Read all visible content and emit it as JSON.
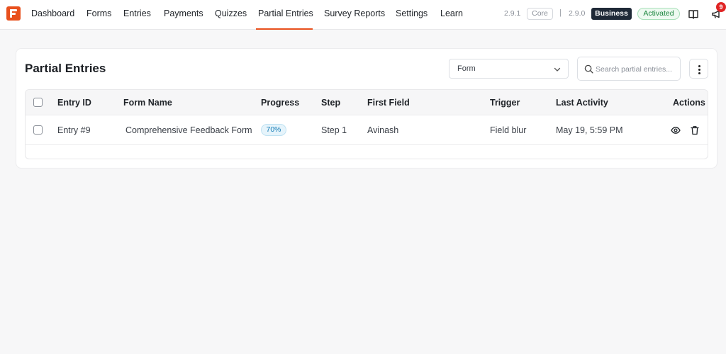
{
  "nav": {
    "items": [
      {
        "label": "Dashboard"
      },
      {
        "label": "Forms"
      },
      {
        "label": "Entries"
      },
      {
        "label": "Payments"
      },
      {
        "label": "Quizzes"
      },
      {
        "label": "Partial Entries",
        "active": true
      },
      {
        "label": "Survey Reports"
      },
      {
        "label": "Settings"
      },
      {
        "label": "Learn"
      }
    ],
    "version_core": "2.9.1",
    "core_label": "Core",
    "separator": "|",
    "version_pro": "2.9.0",
    "plan_label": "Business",
    "status_label": "Activated",
    "notification_count": "9",
    "accent_color": "#e8501d"
  },
  "page": {
    "title": "Partial Entries",
    "form_filter_value": "Form",
    "search_placeholder": "Search partial entries..."
  },
  "table": {
    "headers": {
      "entry_id": "Entry ID",
      "form_name": "Form Name",
      "progress": "Progress",
      "step": "Step",
      "first_field": "First Field",
      "trigger": "Trigger",
      "last_activity": "Last Activity",
      "actions": "Actions"
    },
    "rows": [
      {
        "entry_id": "Entry #9",
        "form_name": "Comprehensive Feedback Form",
        "progress": "70%",
        "step": "Step 1",
        "first_field": "Avinash",
        "trigger": "Field blur",
        "last_activity": "May 19, 5:59 PM"
      }
    ]
  }
}
